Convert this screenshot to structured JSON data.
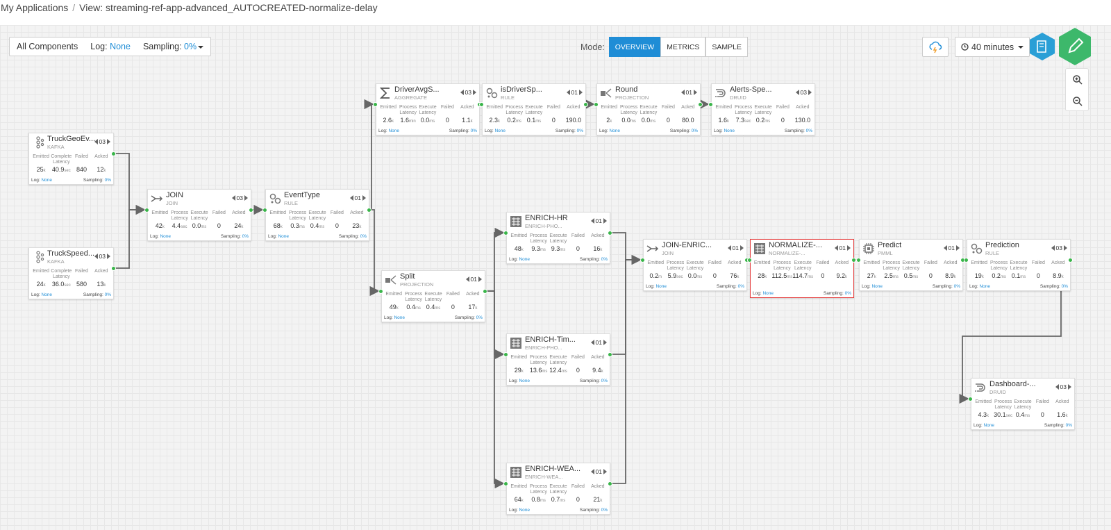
{
  "breadcrumb": {
    "root": "My Applications",
    "separator": "/",
    "current": "View: streaming-ref-app-advanced_AUTOCREATED-normalize-delay"
  },
  "toolbar": {
    "components": "All Components",
    "log_label": "Log:",
    "log_value": "None",
    "sampling_label": "Sampling:",
    "sampling_value": "0%",
    "mode_label": "Mode:",
    "modes": [
      "OVERVIEW",
      "METRICS",
      "SAMPLE"
    ],
    "active_mode": "OVERVIEW",
    "time_range": "40 minutes",
    "icons": {
      "storm": "storm-cloud-icon",
      "clock": "clock-icon",
      "docs": "book-icon",
      "edit": "pencil-icon",
      "zoom_in": "zoom-in-icon",
      "zoom_out": "zoom-out-icon"
    },
    "colors": {
      "accent": "#1f8dd6",
      "docs_hex": "#2a9fd6",
      "edit_hex": "#3db86b",
      "status_dot": "#3ab54a",
      "highlight": "#e43b3b"
    }
  },
  "nodes": [
    {
      "id": "truckgeo",
      "title": "TruckGeoEv...",
      "type": "KAFKA",
      "icon": "kafka-icon",
      "parallelism": "03",
      "metrics": [
        {
          "label": "Emitted",
          "value": "25",
          "unit": "k"
        },
        {
          "label": "Complete Latency",
          "value": "40.9",
          "unit": "sec"
        },
        {
          "label": "Failed",
          "value": "840",
          "unit": ""
        },
        {
          "label": "Acked",
          "value": "12",
          "unit": "k"
        }
      ],
      "log": "None",
      "sampling": "0%"
    },
    {
      "id": "truckspeed",
      "title": "TruckSpeed...",
      "type": "KAFKA",
      "icon": "kafka-icon",
      "parallelism": "03",
      "metrics": [
        {
          "label": "Emitted",
          "value": "24",
          "unit": "k"
        },
        {
          "label": "Complete Latency",
          "value": "36.0",
          "unit": "sec"
        },
        {
          "label": "Failed",
          "value": "580",
          "unit": ""
        },
        {
          "label": "Acked",
          "value": "13",
          "unit": "k"
        }
      ],
      "log": "None",
      "sampling": "0%"
    },
    {
      "id": "join",
      "title": "JOIN",
      "type": "JOIN",
      "icon": "join-icon",
      "parallelism": "03",
      "metrics": [
        {
          "label": "Emitted",
          "value": "42",
          "unit": "k"
        },
        {
          "label": "Process Latency",
          "value": "4.4",
          "unit": "sec"
        },
        {
          "label": "Execute Latency",
          "value": "0.0",
          "unit": "ms"
        },
        {
          "label": "Failed",
          "value": "0",
          "unit": ""
        },
        {
          "label": "Acked",
          "value": "24",
          "unit": "k"
        }
      ],
      "log": "None",
      "sampling": "0%"
    },
    {
      "id": "eventtype",
      "title": "EventType",
      "type": "RULE",
      "icon": "rule-icon",
      "parallelism": "01",
      "metrics": [
        {
          "label": "Emitted",
          "value": "68",
          "unit": "k"
        },
        {
          "label": "Process Latency",
          "value": "0.3",
          "unit": "ms"
        },
        {
          "label": "Execute Latency",
          "value": "0.4",
          "unit": "ms"
        },
        {
          "label": "Failed",
          "value": "0",
          "unit": ""
        },
        {
          "label": "Acked",
          "value": "23",
          "unit": "k"
        }
      ],
      "log": "None",
      "sampling": "0%"
    },
    {
      "id": "driveravg",
      "title": "DriverAvgS...",
      "type": "AGGREGATE",
      "icon": "sigma-icon",
      "parallelism": "03",
      "metrics": [
        {
          "label": "Emitted",
          "value": "2.6",
          "unit": "k"
        },
        {
          "label": "Process Latency",
          "value": "1.6",
          "unit": "min"
        },
        {
          "label": "Execute Latency",
          "value": "0.0",
          "unit": "ms"
        },
        {
          "label": "Failed",
          "value": "0",
          "unit": ""
        },
        {
          "label": "Acked",
          "value": "1.1",
          "unit": "k"
        }
      ],
      "log": "None",
      "sampling": "0%"
    },
    {
      "id": "isdriver",
      "title": "isDriverSp...",
      "type": "RULE",
      "icon": "rule-icon",
      "parallelism": "01",
      "metrics": [
        {
          "label": "Emitted",
          "value": "2.3",
          "unit": "k"
        },
        {
          "label": "Process Latency",
          "value": "0.2",
          "unit": "ms"
        },
        {
          "label": "Execute Latency",
          "value": "0.1",
          "unit": "ms"
        },
        {
          "label": "Failed",
          "value": "0",
          "unit": ""
        },
        {
          "label": "Acked",
          "value": "190.0",
          "unit": ""
        }
      ],
      "log": "None",
      "sampling": "0%"
    },
    {
      "id": "round",
      "title": "Round",
      "type": "PROJECTION",
      "icon": "projection-icon",
      "parallelism": "01",
      "metrics": [
        {
          "label": "Emitted",
          "value": "2",
          "unit": "k"
        },
        {
          "label": "Process Latency",
          "value": "0.0",
          "unit": "ms"
        },
        {
          "label": "Execute Latency",
          "value": "0.0",
          "unit": "ms"
        },
        {
          "label": "Failed",
          "value": "0",
          "unit": ""
        },
        {
          "label": "Acked",
          "value": "80.0",
          "unit": ""
        }
      ],
      "log": "None",
      "sampling": "0%"
    },
    {
      "id": "alerts",
      "title": "Alerts-Spe...",
      "type": "DRUID",
      "icon": "druid-icon",
      "parallelism": "03",
      "metrics": [
        {
          "label": "Emitted",
          "value": "1.6",
          "unit": "k"
        },
        {
          "label": "Process Latency",
          "value": "7.3",
          "unit": "sec"
        },
        {
          "label": "Execute Latency",
          "value": "0.2",
          "unit": "ms"
        },
        {
          "label": "Failed",
          "value": "0",
          "unit": ""
        },
        {
          "label": "Acked",
          "value": "130.0",
          "unit": ""
        }
      ],
      "log": "None",
      "sampling": "0%"
    },
    {
      "id": "split",
      "title": "Split",
      "type": "PROJECTION",
      "icon": "projection-icon",
      "parallelism": "01",
      "metrics": [
        {
          "label": "Emitted",
          "value": "49",
          "unit": "k"
        },
        {
          "label": "Process Latency",
          "value": "0.4",
          "unit": "ms"
        },
        {
          "label": "Execute Latency",
          "value": "0.4",
          "unit": "ms"
        },
        {
          "label": "Failed",
          "value": "0",
          "unit": ""
        },
        {
          "label": "Acked",
          "value": "17",
          "unit": "k"
        }
      ],
      "log": "None",
      "sampling": "0%"
    },
    {
      "id": "enrichhr",
      "title": "ENRICH-HR",
      "type": "ENRICH-PHO...",
      "icon": "enrich-icon",
      "parallelism": "01",
      "metrics": [
        {
          "label": "Emitted",
          "value": "48",
          "unit": "k"
        },
        {
          "label": "Process Latency",
          "value": "9.3",
          "unit": "ms"
        },
        {
          "label": "Execute Latency",
          "value": "9.3",
          "unit": "ms"
        },
        {
          "label": "Failed",
          "value": "0",
          "unit": ""
        },
        {
          "label": "Acked",
          "value": "16",
          "unit": "k"
        }
      ],
      "log": "None",
      "sampling": "0%"
    },
    {
      "id": "enrichtim",
      "title": "ENRICH-Tim...",
      "type": "ENRICH-PHO...",
      "icon": "enrich-icon",
      "parallelism": "01",
      "metrics": [
        {
          "label": "Emitted",
          "value": "29",
          "unit": "k"
        },
        {
          "label": "Process Latency",
          "value": "13.6",
          "unit": "ms"
        },
        {
          "label": "Execute Latency",
          "value": "12.4",
          "unit": "ms"
        },
        {
          "label": "Failed",
          "value": "0",
          "unit": ""
        },
        {
          "label": "Acked",
          "value": "9.4",
          "unit": "k"
        }
      ],
      "log": "None",
      "sampling": "0%"
    },
    {
      "id": "enrichwea",
      "title": "ENRICH-WEA...",
      "type": "ENRICH-WEA...",
      "icon": "enrich-icon",
      "parallelism": "01",
      "metrics": [
        {
          "label": "Emitted",
          "value": "64",
          "unit": "k"
        },
        {
          "label": "Process Latency",
          "value": "0.8",
          "unit": "ms"
        },
        {
          "label": "Execute Latency",
          "value": "0.7",
          "unit": "ms"
        },
        {
          "label": "Failed",
          "value": "0",
          "unit": ""
        },
        {
          "label": "Acked",
          "value": "21",
          "unit": "k"
        }
      ],
      "log": "None",
      "sampling": "0%"
    },
    {
      "id": "joinenric",
      "title": "JOIN-ENRIC...",
      "type": "JOIN",
      "icon": "join-icon",
      "parallelism": "01",
      "metrics": [
        {
          "label": "Emitted",
          "value": "0.2",
          "unit": "m"
        },
        {
          "label": "Process Latency",
          "value": "5.9",
          "unit": "sec"
        },
        {
          "label": "Execute Latency",
          "value": "0.0",
          "unit": "ms"
        },
        {
          "label": "Failed",
          "value": "0",
          "unit": ""
        },
        {
          "label": "Acked",
          "value": "76",
          "unit": "k"
        }
      ],
      "log": "None",
      "sampling": "0%"
    },
    {
      "id": "normalize",
      "title": "NORMALIZE-...",
      "type": "NORMALIZE-...",
      "icon": "enrich-icon",
      "parallelism": "01",
      "metrics": [
        {
          "label": "Emitted",
          "value": "28",
          "unit": "k"
        },
        {
          "label": "Process Latency",
          "value": "112.5",
          "unit": "ms"
        },
        {
          "label": "Execute Latency",
          "value": "114.7",
          "unit": "ms"
        },
        {
          "label": "Failed",
          "value": "0",
          "unit": ""
        },
        {
          "label": "Acked",
          "value": "9.2",
          "unit": "k"
        }
      ],
      "log": "None",
      "sampling": "0%"
    },
    {
      "id": "predict",
      "title": "Predict",
      "type": "PMML",
      "icon": "chip-icon",
      "parallelism": "01",
      "metrics": [
        {
          "label": "Emitted",
          "value": "27",
          "unit": "k"
        },
        {
          "label": "Process Latency",
          "value": "2.5",
          "unit": "ms"
        },
        {
          "label": "Execute Latency",
          "value": "0.5",
          "unit": "ms"
        },
        {
          "label": "Failed",
          "value": "0",
          "unit": ""
        },
        {
          "label": "Acked",
          "value": "8.9",
          "unit": "k"
        }
      ],
      "log": "None",
      "sampling": "0%"
    },
    {
      "id": "prediction",
      "title": "Prediction",
      "type": "RULE",
      "icon": "rule-icon",
      "parallelism": "03",
      "metrics": [
        {
          "label": "Emitted",
          "value": "19",
          "unit": "k"
        },
        {
          "label": "Process Latency",
          "value": "0.2",
          "unit": "ms"
        },
        {
          "label": "Execute Latency",
          "value": "0.1",
          "unit": "ms"
        },
        {
          "label": "Failed",
          "value": "0",
          "unit": ""
        },
        {
          "label": "Acked",
          "value": "8.9",
          "unit": "k"
        }
      ],
      "log": "None",
      "sampling": "0%"
    },
    {
      "id": "dashboard",
      "title": "Dashboard-...",
      "type": "DRUID",
      "icon": "druid-icon",
      "parallelism": "03",
      "metrics": [
        {
          "label": "Emitted",
          "value": "4.3",
          "unit": "k"
        },
        {
          "label": "Process Latency",
          "value": "30.1",
          "unit": "sec"
        },
        {
          "label": "Execute Latency",
          "value": "0.4",
          "unit": "ms"
        },
        {
          "label": "Failed",
          "value": "0",
          "unit": ""
        },
        {
          "label": "Acked",
          "value": "1.6",
          "unit": "k"
        }
      ],
      "log": "None",
      "sampling": "0%"
    }
  ],
  "edges": [
    [
      "truckgeo",
      "join"
    ],
    [
      "truckspeed",
      "join"
    ],
    [
      "join",
      "eventtype"
    ],
    [
      "eventtype",
      "driveravg"
    ],
    [
      "eventtype",
      "split"
    ],
    [
      "driveravg",
      "isdriver"
    ],
    [
      "isdriver",
      "round"
    ],
    [
      "round",
      "alerts"
    ],
    [
      "split",
      "enrichhr"
    ],
    [
      "split",
      "enrichtim"
    ],
    [
      "split",
      "enrichwea"
    ],
    [
      "enrichhr",
      "joinenric"
    ],
    [
      "enrichtim",
      "joinenric"
    ],
    [
      "enrichwea",
      "joinenric"
    ],
    [
      "joinenric",
      "normalize"
    ],
    [
      "normalize",
      "predict"
    ],
    [
      "predict",
      "prediction"
    ],
    [
      "prediction",
      "dashboard"
    ]
  ],
  "highlighted_node": "normalize"
}
